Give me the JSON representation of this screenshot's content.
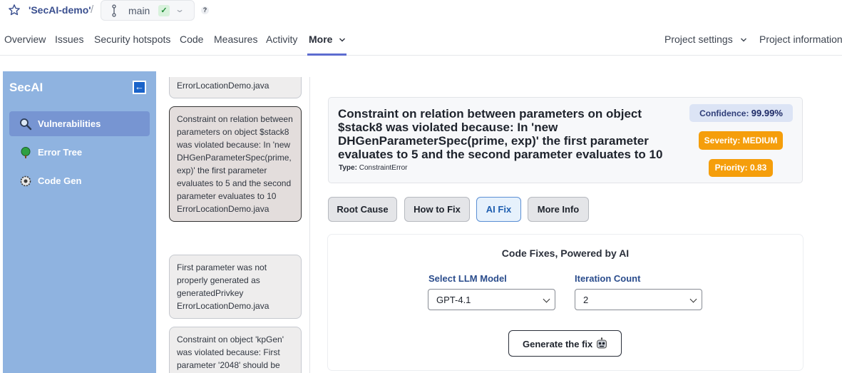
{
  "project": {
    "name": "'SecAI-demo'",
    "separator": "/",
    "branch": "main",
    "branch_status": "✓",
    "help": "?"
  },
  "nav": {
    "items": [
      "Overview",
      "Issues",
      "Security hotspots",
      "Code",
      "Measures",
      "Activity",
      "More"
    ],
    "active": "More",
    "right_items": [
      "Project settings",
      "Project information"
    ]
  },
  "sidebar": {
    "title": "SecAI",
    "collapse_icon": "←",
    "items": [
      {
        "label": "Vulnerabilities",
        "icon": "magnifier-icon",
        "active": true
      },
      {
        "label": "Error Tree",
        "icon": "tree-icon",
        "active": false
      },
      {
        "label": "Code Gen",
        "icon": "gear-icon",
        "active": false
      }
    ]
  },
  "issues": [
    {
      "text": "ErrorLocationDemo.java",
      "selected": false
    },
    {
      "text": "Constraint on relation between parameters on object $stack8 was violated because: In 'new DHGenParameterSpec(prime, exp)' the first parameter evaluates to 5 and the second parameter evaluates to 10 ErrorLocationDemo.java",
      "selected": true
    },
    {
      "text": "First parameter was not properly generated as generatedPrivkey ErrorLocationDemo.java",
      "selected": false
    },
    {
      "text": "Constraint on object 'kpGen' was violated because: First parameter '2048' should be",
      "selected": false
    }
  ],
  "detail": {
    "title": "Constraint on relation between parameters on object $stack8 was violated because: In 'new DHGenParameterSpec(prime, exp)' the first parameter evaluates to 5 and the second parameter evaluates to 10",
    "type_label": "Type:",
    "type_value": "ConstraintError",
    "confidence_label": "Confidence:",
    "confidence_value": "99.99%",
    "severity": "Severity: MEDIUM",
    "priority": "Priority: 0.83",
    "severity_color": "#f59e0b"
  },
  "tabs": [
    "Root Cause",
    "How to Fix",
    "AI Fix",
    "More Info"
  ],
  "active_tab": "AI Fix",
  "fix": {
    "heading": "Code Fixes, Powered by AI",
    "model_label": "Select LLM Model",
    "model_value": "GPT-4.1",
    "iteration_label": "Iteration Count",
    "iteration_value": "2",
    "generate_label": "Generate the fix"
  },
  "colors": {
    "sidebar": "#8fb3e0",
    "sidebar_active": "#7795d2",
    "accent": "#5d6cd0"
  }
}
